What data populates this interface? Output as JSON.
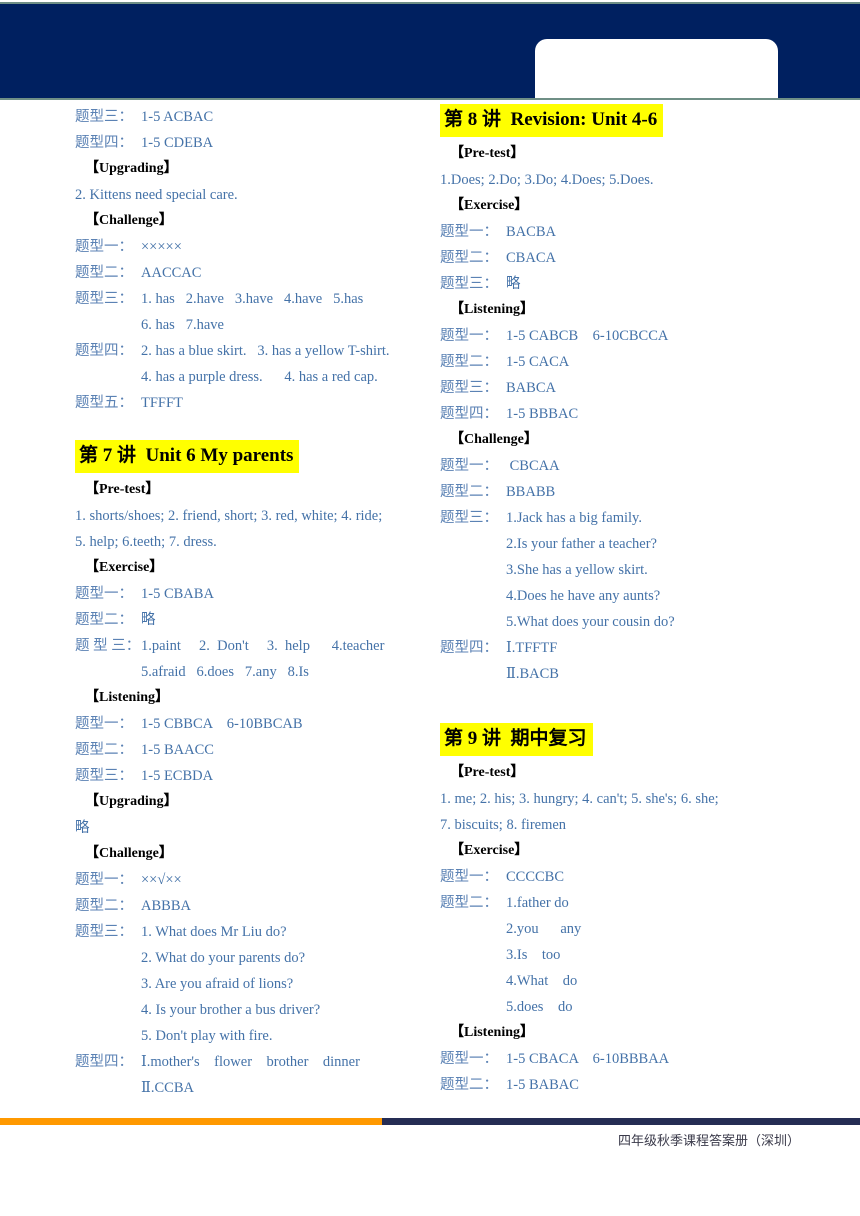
{
  "colors": {
    "header_navy": "#002060",
    "header_rule": "#6f8f86",
    "body_blue": "#4472a8",
    "label_blue": "#5b82b4",
    "highlight_yellow": "#FFFF00",
    "footer_orange": "#FF9900",
    "footer_navy": "#252D54"
  },
  "footer": {
    "caption": "四年级秋季课程答案册（深圳）"
  },
  "left_column": {
    "continued_block": [
      {
        "label": "题型三：",
        "answer": "1-5 ACBAC"
      },
      {
        "label": "题型四：",
        "answer": "1-5 CDEBA"
      }
    ],
    "upgrading_head": "【Upgrading】",
    "upgrading_lines": [
      "2. Kittens need special care."
    ],
    "challenge_head": "【Challenge】",
    "challenge_items": [
      {
        "label": "题型一：",
        "answer": "×××××"
      },
      {
        "label": "题型二：",
        "answer": "AACCAC"
      },
      {
        "label": "题型三：",
        "answer": "1. has   2.have   3.have   4.have   5.has"
      },
      {
        "label": "",
        "answer": "6. has   7.have"
      },
      {
        "label": "题型四：",
        "answer": "2. has a blue skirt.   3. has a yellow T-shirt."
      },
      {
        "label": "",
        "answer": "4. has a purple dress.      4. has a red cap."
      },
      {
        "label": "题型五：",
        "answer": "TFFFT"
      }
    ],
    "lecture7": {
      "heading": "第 7 讲  Unit 6 My parents",
      "pretest_head": "【Pre-test】",
      "pretest_lines": [
        "1. shorts/shoes; 2. friend, short; 3. red, white; 4. ride;",
        "5. help; 6.teeth; 7. dress."
      ],
      "exercise_head": "【Exercise】",
      "exercise_items": [
        {
          "label": "题型一：",
          "answer": "1-5 CBABA"
        },
        {
          "label": "题型二：",
          "answer": "略"
        },
        {
          "label": "题 型 三：",
          "answer": "1.paint     2.  Don't     3.  help      4.teacher"
        },
        {
          "label": "",
          "answer": "5.afraid   6.does   7.any   8.Is"
        }
      ],
      "listening_head": "【Listening】",
      "listening_items": [
        {
          "label": "题型一：",
          "answer": "1-5 CBBCA    6-10BBCAB"
        },
        {
          "label": "题型二：",
          "answer": "1-5 BAACC"
        },
        {
          "label": "题型三：",
          "answer": "1-5 ECBDA"
        }
      ],
      "upgrading_head": "【Upgrading】",
      "upgrading_lines": [
        "略"
      ],
      "challenge_head": "【Challenge】",
      "challenge_items": [
        {
          "label": "题型一：",
          "answer": "××√××"
        },
        {
          "label": "题型二：",
          "answer": "ABBBA"
        },
        {
          "label": "题型三：",
          "answer": "1. What does Mr Liu do?"
        },
        {
          "label": "",
          "answer": "2. What do your parents do?"
        },
        {
          "label": "",
          "answer": "3. Are you afraid of lions?"
        },
        {
          "label": "",
          "answer": "4. Is your brother a bus driver?"
        },
        {
          "label": "",
          "answer": "5. Don't play with fire."
        },
        {
          "label": "题型四：",
          "answer": "Ⅰ.mother's    flower    brother    dinner"
        },
        {
          "label": "",
          "answer": "Ⅱ.CCBA"
        }
      ]
    }
  },
  "right_column": {
    "lecture8": {
      "heading": "第 8 讲  Revision: Unit 4-6",
      "pretest_head": "【Pre-test】",
      "pretest_lines": [
        "1.Does; 2.Do; 3.Do; 4.Does; 5.Does."
      ],
      "exercise_head": "【Exercise】",
      "exercise_items": [
        {
          "label": "题型一：",
          "answer": "BACBA"
        },
        {
          "label": "题型二：",
          "answer": "CBACA"
        },
        {
          "label": "题型三：",
          "answer": "略"
        }
      ],
      "listening_head": "【Listening】",
      "listening_items": [
        {
          "label": "题型一：",
          "answer": "1-5 CABCB    6-10CBCCA"
        },
        {
          "label": "题型二：",
          "answer": "1-5 CACA"
        },
        {
          "label": "题型三：",
          "answer": "BABCA"
        },
        {
          "label": "题型四：",
          "answer": "1-5 BBBAC"
        }
      ],
      "challenge_head": "【Challenge】",
      "challenge_items": [
        {
          "label": "题型一：",
          "answer": " CBCAA"
        },
        {
          "label": "题型二：",
          "answer": "BBABB"
        },
        {
          "label": "题型三：",
          "answer": "1.Jack has a big family."
        },
        {
          "label": "",
          "answer": "2.Is your father a teacher?"
        },
        {
          "label": "",
          "answer": "3.She has a yellow skirt."
        },
        {
          "label": "",
          "answer": "4.Does he have any aunts?"
        },
        {
          "label": "",
          "answer": "5.What does your cousin do?"
        },
        {
          "label": "题型四：",
          "answer": "Ⅰ.TFFTF"
        },
        {
          "label": "",
          "answer": "Ⅱ.BACB"
        }
      ]
    },
    "lecture9": {
      "heading": "第 9 讲  期中复习",
      "pretest_head": "【Pre-test】",
      "pretest_lines": [
        "1. me; 2. his; 3. hungry; 4. can't; 5. she's; 6. she;",
        "7. biscuits; 8. firemen"
      ],
      "exercise_head": "【Exercise】",
      "exercise_items": [
        {
          "label": "题型一：",
          "answer": "CCCCBC"
        },
        {
          "label": "题型二：",
          "answer": "1.father do"
        },
        {
          "label": "",
          "answer": "2.you      any"
        },
        {
          "label": "",
          "answer": "3.Is    too"
        },
        {
          "label": "",
          "answer": "4.What    do"
        },
        {
          "label": "",
          "answer": "5.does    do"
        }
      ],
      "listening_head": "【Listening】",
      "listening_items": [
        {
          "label": "题型一：",
          "answer": "1-5 CBACA    6-10BBBAA"
        },
        {
          "label": "题型二：",
          "answer": "1-5 BABAC"
        }
      ]
    }
  }
}
